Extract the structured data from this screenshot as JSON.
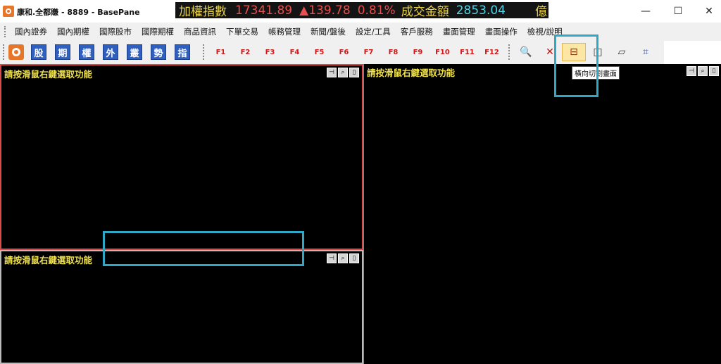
{
  "window": {
    "title": "康和.全都賺 - 8889 - BasePane",
    "controls": [
      "—",
      "☐",
      "✕"
    ]
  },
  "ticker": {
    "label_index": "加權指數",
    "index_value": "17341.89",
    "change": "▲139.78",
    "change_pct": "0.81%",
    "label_volume": "成交金額",
    "volume_value": "2853.04",
    "volume_unit": "億"
  },
  "menu": {
    "items": [
      "國內證券",
      "國內期權",
      "國際股市",
      "國際期權",
      "商品資訊",
      "下單交易",
      "帳務管理",
      "新聞/盤後",
      "設定/工具",
      "客戶服務",
      "畫面管理",
      "畫面操作",
      "檢視/說明"
    ]
  },
  "toolbar": {
    "channel_buttons": [
      "股",
      "期",
      "權",
      "外",
      "叢",
      "勢",
      "指"
    ],
    "fkeys": [
      "F1",
      "F2",
      "F3",
      "F4",
      "F5",
      "F6",
      "F7",
      "F8",
      "F9",
      "F10",
      "F11",
      "F12"
    ],
    "tools": [
      {
        "icon": "zoom-icon",
        "glyph": "🔍"
      },
      {
        "icon": "close-pane-icon",
        "glyph": "✕"
      },
      {
        "icon": "split-horizontal-icon",
        "glyph": "⊟"
      },
      {
        "icon": "split-vertical-icon",
        "glyph": "◫"
      },
      {
        "icon": "eraser-icon",
        "glyph": "▱"
      },
      {
        "icon": "crop-icon",
        "glyph": "⌗"
      }
    ],
    "tooltip": "橫向切割畫面"
  },
  "panes": {
    "top_left": {
      "title": "請按滑鼠右鍵選取功能"
    },
    "bottom_left": {
      "title": "請按滑鼠右鍵選取功能"
    },
    "right": {
      "title": "請按滑鼠右鍵選取功能"
    },
    "buttons": [
      "⊣",
      "⌕",
      "▯"
    ]
  },
  "colors": {
    "pane_bg": "#000000",
    "pane_title": "#f0e24a",
    "active_border": "#d94b4b",
    "highlight": "#2fa8c8",
    "channel_btn": "#2f5fbf",
    "fkey": "#d01818"
  }
}
